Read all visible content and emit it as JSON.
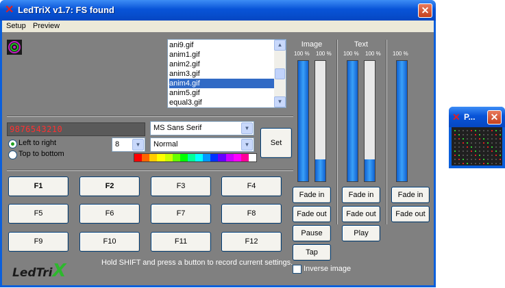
{
  "window": {
    "title": "LedTriX v1.7: FS found",
    "app_icon": "ledtrix-x-logo",
    "close_icon": "close-icon"
  },
  "menu": [
    "Setup",
    "Preview"
  ],
  "preview_icon": "spiral-icon",
  "animation_list": {
    "items": [
      "ani9.gif",
      "anim1.gif",
      "anim2.gif",
      "anim3.gif",
      "anim4.gif",
      "anim5.gif",
      "equal3.gif"
    ],
    "selected": "anim4.gif"
  },
  "text_panel": {
    "led_text": "9876543210",
    "font_name": "MS Sans Serif",
    "font_size": "8",
    "font_style": "Normal",
    "set_label": "Set",
    "direction_options": [
      "Left to right",
      "Top to bottom"
    ],
    "direction_selected": "Left to right"
  },
  "palette": [
    "#ff0000",
    "#ff6600",
    "#ffcc00",
    "#ffff00",
    "#ccff00",
    "#66ff00",
    "#00ff00",
    "#00ff99",
    "#00ffff",
    "#0099ff",
    "#0033ff",
    "#6600ff",
    "#cc00ff",
    "#ff00ff",
    "#ff0099",
    "#ffffff"
  ],
  "preset_buttons": [
    "F1",
    "F2",
    "F3",
    "F4",
    "F5",
    "F6",
    "F7",
    "F8",
    "F9",
    "F10",
    "F11",
    "F12"
  ],
  "preset_bold": [
    "F1",
    "F2"
  ],
  "hint": "Hold SHIFT and press a button to record current settings.",
  "brand": {
    "prefix": "LedTri",
    "suffix": "X"
  },
  "channels": {
    "image": {
      "label": "Image",
      "levels_label": [
        "100 %",
        "100 %"
      ],
      "bar_fill": [
        1.0,
        0.18
      ],
      "buttons": [
        "Fade in",
        "Fade out",
        "Pause",
        "Tap"
      ]
    },
    "text": {
      "label": "Text",
      "levels_label": [
        "100 %",
        "100 %"
      ],
      "bar_fill": [
        1.0,
        0.18
      ],
      "buttons": [
        "Fade in",
        "Fade out",
        "Play"
      ]
    },
    "master": {
      "levels_label": [
        "100 %"
      ],
      "bar_fill": [
        1.0
      ],
      "buttons": [
        "Fade in",
        "Fade out"
      ]
    }
  },
  "inverse_image_label": "Inverse image",
  "preview_window": {
    "title": "P...",
    "close_icon": "close-icon"
  }
}
